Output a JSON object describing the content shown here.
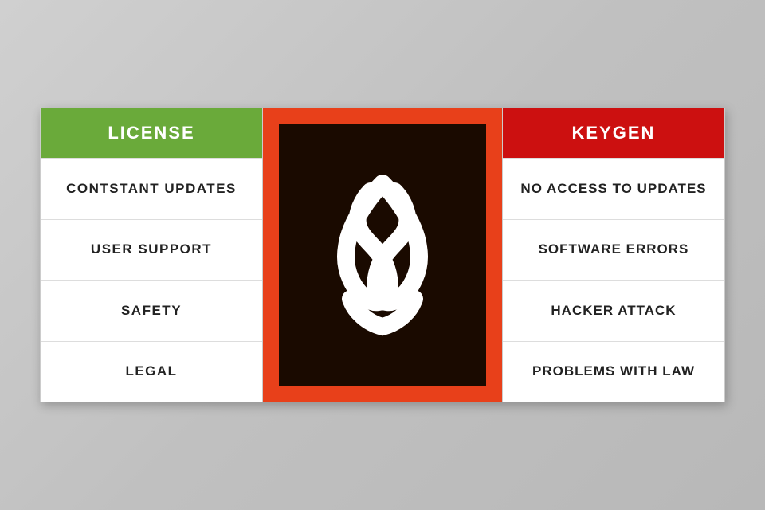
{
  "license": {
    "header": "LICENSE",
    "items": [
      "CONTSTANT UPDATES",
      "USER SUPPORT",
      "SAFETY",
      "LEGAL"
    ]
  },
  "keygen": {
    "header": "KEYGEN",
    "items": [
      "NO ACCESS TO UPDATES",
      "SOFTWARE ERRORS",
      "HACKER ATTACK",
      "PROBLEMS WITH LAW"
    ]
  },
  "colors": {
    "license_green": "#6aaa3a",
    "keygen_red": "#cc1010",
    "adobe_orange": "#e8401a",
    "adobe_dark": "#1a0a00"
  }
}
